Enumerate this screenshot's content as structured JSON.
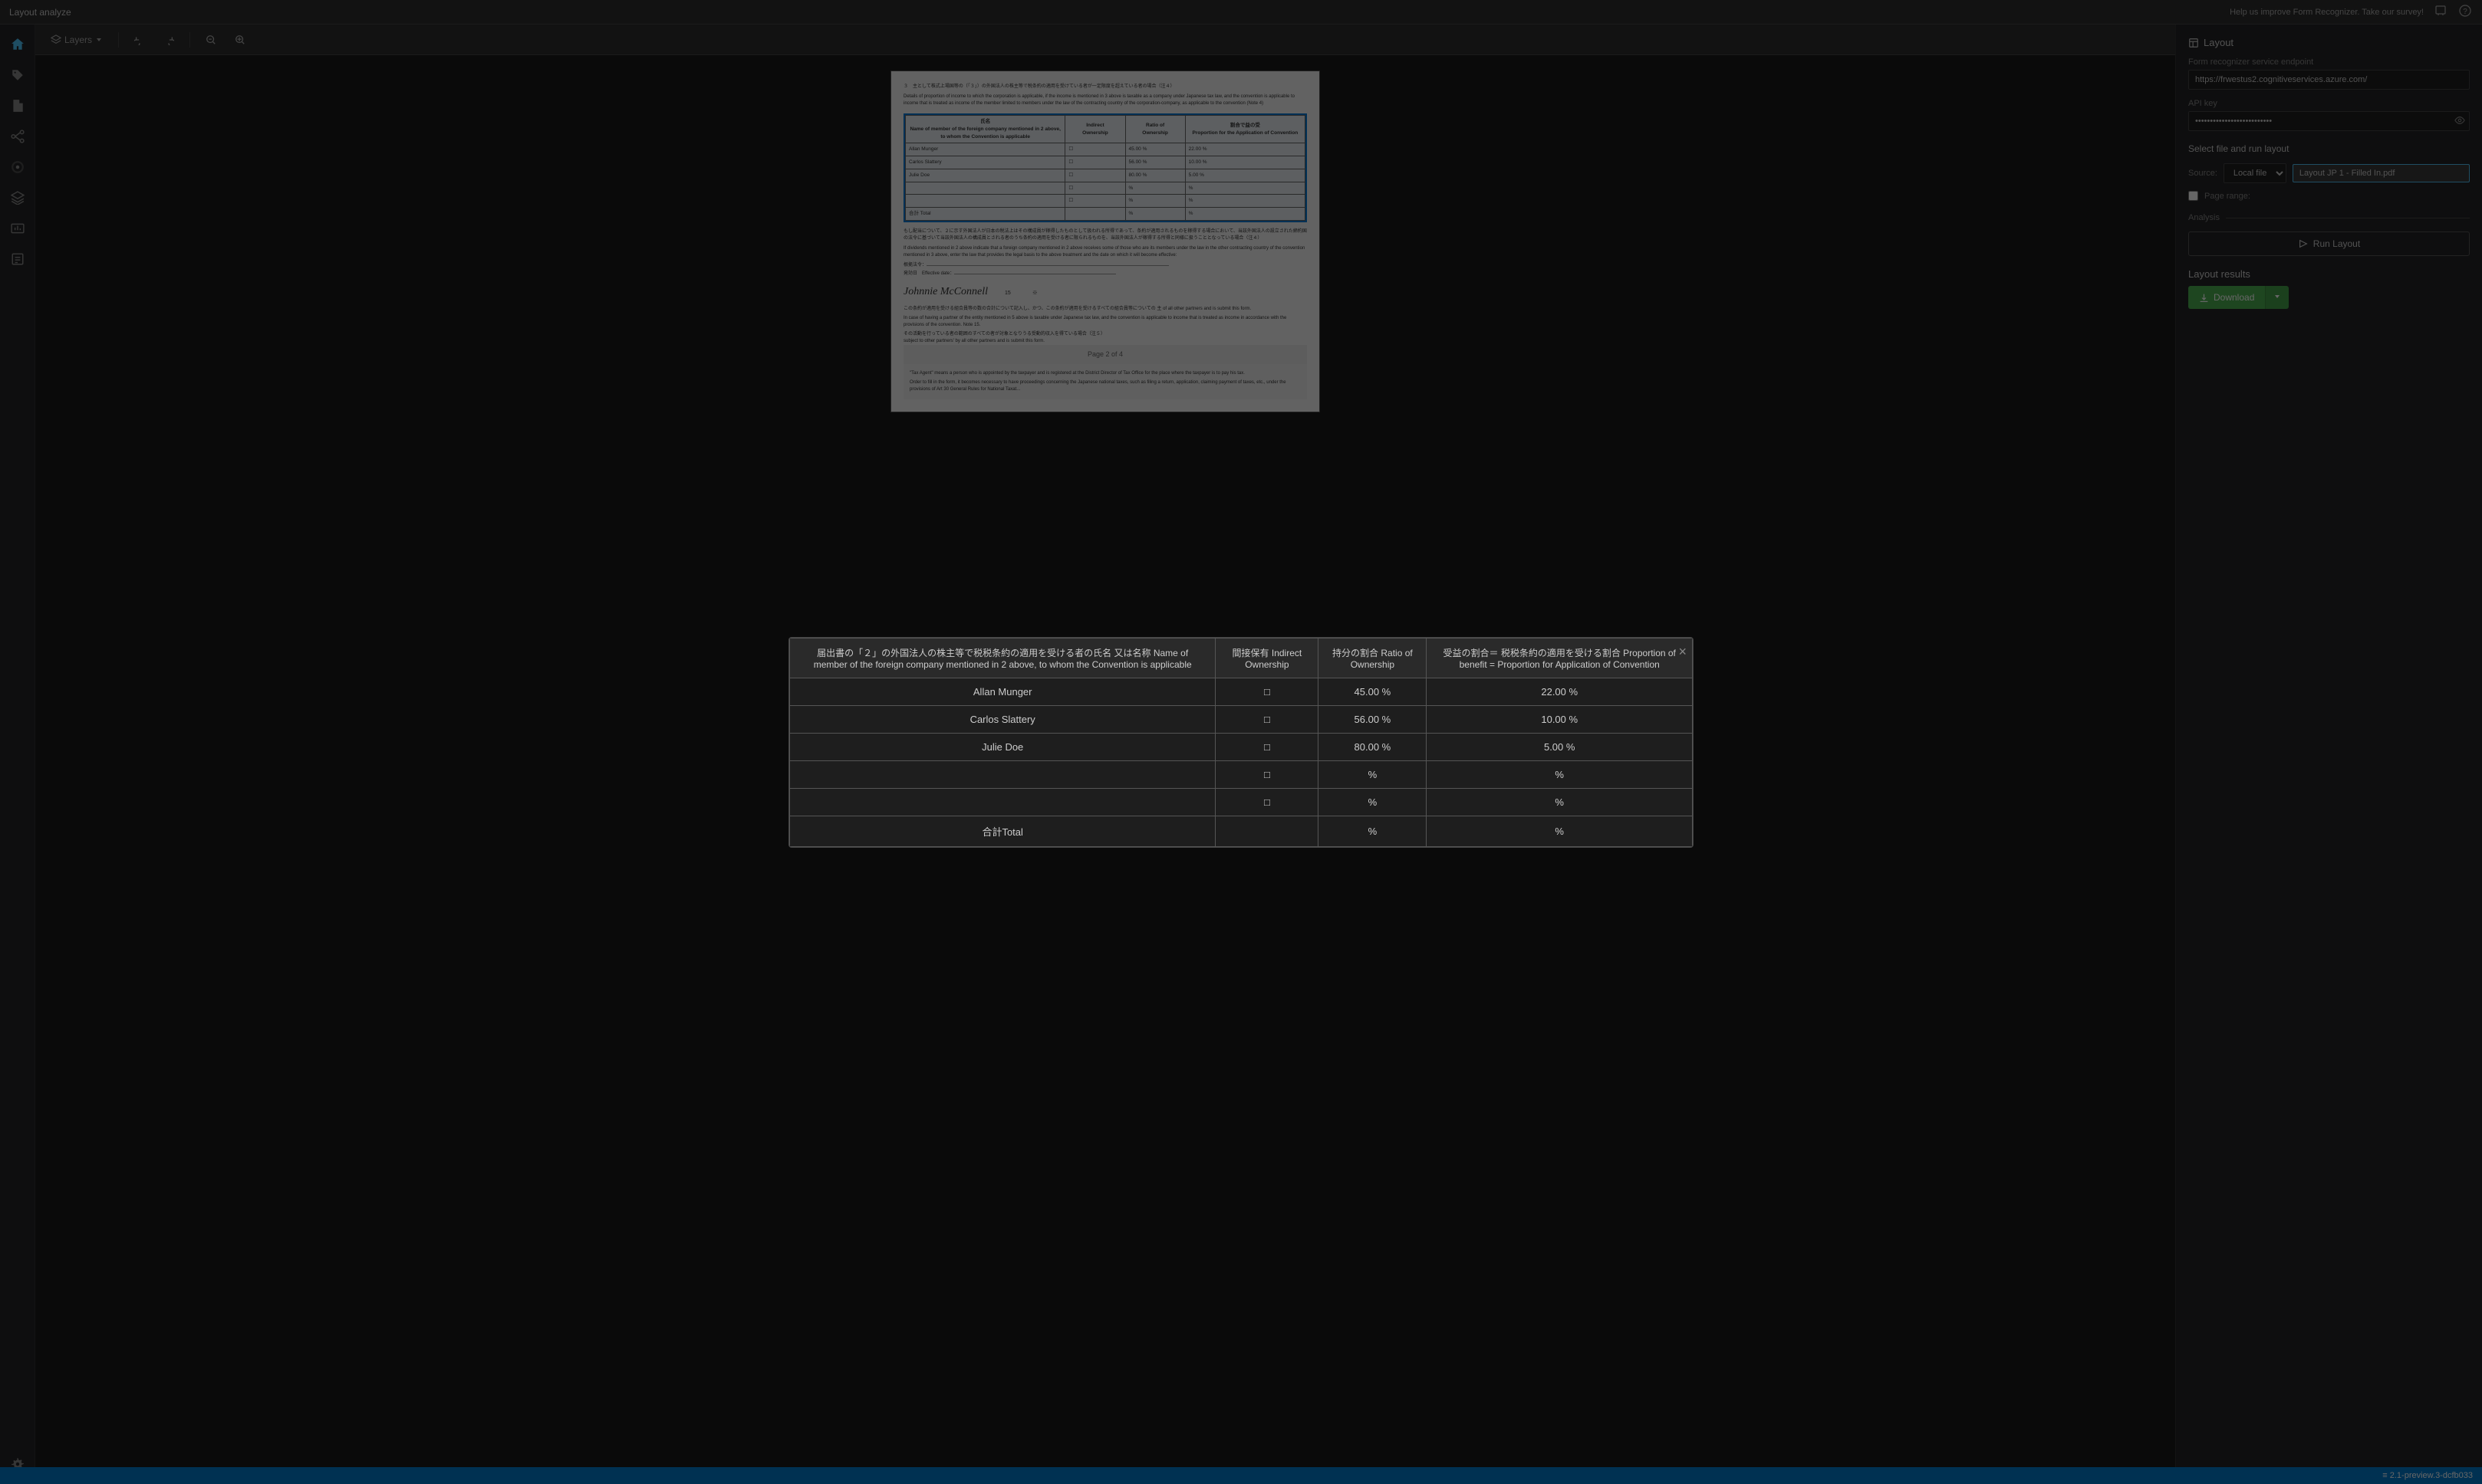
{
  "app": {
    "title": "Layout analyze",
    "version": "2.1-preview.3-dcfb033",
    "help_text": "Help us improve Form Recognizer. Take our survey!"
  },
  "topbar": {
    "title": "Layout analyze",
    "help_text": "Help us improve Form Recognizer. Take our survey!"
  },
  "toolbar": {
    "layers_label": "Layers",
    "undo_title": "Undo",
    "redo_title": "Redo",
    "zoom_out_title": "Zoom out",
    "zoom_in_title": "Zoom in"
  },
  "right_panel": {
    "section_title": "Layout",
    "form_endpoint_label": "Form recognizer service endpoint",
    "form_endpoint_value": "https://frwestus2.cognitiveservices.azure.com/",
    "api_key_label": "API key",
    "api_key_value": "••••••••••••••••••••••••••",
    "select_file_title": "Select file and run layout",
    "source_label": "Source:",
    "source_option": "Local file",
    "file_name": "Layout JP 1 - Filled In.pdf",
    "page_range_label": "Page range:",
    "analysis_label": "Analysis",
    "run_layout_label": "Run Layout",
    "layout_results_label": "Layout results",
    "download_label": "Download"
  },
  "modal": {
    "close_label": "×",
    "table": {
      "headers": [
        "届出書の「２」の外国法人の株主等で税税条約の適用を受ける者の氏名 又は名称 Name of member of the foreign company mentioned in 2 above, to whom the Convention is applicable",
        "間接保有 Indirect Ownership",
        "持分の割合 Ratio of Ownership",
        "受益の割合＝ 税税条約の適用を受ける割合 Proportion of benefit = Proportion for Application of Convention"
      ],
      "rows": [
        {
          "name": "Allan Munger",
          "checkbox": "□",
          "ratio": "45.00 %",
          "benefit": "22.00 %"
        },
        {
          "name": "Carlos Slattery",
          "checkbox": "□",
          "ratio": "56.00 %",
          "benefit": "10.00 %"
        },
        {
          "name": "Julie Doe",
          "checkbox": "□",
          "ratio": "80.00 %",
          "benefit": "5.00 %"
        },
        {
          "name": "",
          "checkbox": "□",
          "ratio": "%",
          "benefit": "%"
        },
        {
          "name": "",
          "checkbox": "□",
          "ratio": "%",
          "benefit": "%"
        },
        {
          "name": "合計Total",
          "checkbox": "",
          "ratio": "%",
          "benefit": "%"
        }
      ]
    }
  },
  "document": {
    "page_label": "Page 2 of 4",
    "signature": "Johnnie McConnell"
  },
  "statusbar": {
    "version": "≡ 2.1-preview.3-dcfb033"
  }
}
